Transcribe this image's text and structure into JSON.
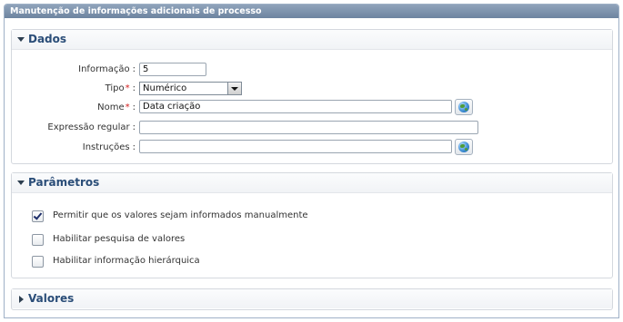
{
  "window": {
    "title": "Manutenção de informações adicionais de processo"
  },
  "dados": {
    "title": "Dados",
    "informacao": {
      "label": "Informação",
      "value": "5"
    },
    "tipo": {
      "label": "Tipo",
      "value": "Numérico"
    },
    "nome": {
      "label": "Nome",
      "value": "Data criação"
    },
    "expressao": {
      "label": "Expressão regular",
      "value": ""
    },
    "instrucoes": {
      "label": "Instruções",
      "value": ""
    },
    "colon": ":",
    "required_mark": "*"
  },
  "parametros": {
    "title": "Parâmetros",
    "options": [
      {
        "label": "Permitir que os valores sejam informados manualmente",
        "checked": true
      },
      {
        "label": "Habilitar pesquisa de valores",
        "checked": false
      },
      {
        "label": "Habilitar informação hierárquica",
        "checked": false
      }
    ]
  },
  "valores": {
    "title": "Valores"
  },
  "icons": {
    "section_expanded": "chevron-down-icon",
    "section_collapsed": "chevron-right-icon",
    "translate": "globe-icon"
  }
}
